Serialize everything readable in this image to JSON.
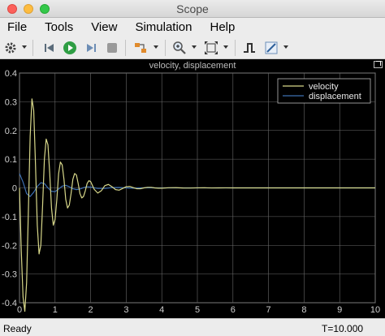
{
  "window": {
    "title": "Scope"
  },
  "menu": [
    "File",
    "Tools",
    "View",
    "Simulation",
    "Help"
  ],
  "toolbar": {
    "icons": [
      "gear-icon",
      "step-back-icon",
      "run-icon",
      "step-forward-icon",
      "stop-icon",
      "highlight-block-icon",
      "zoom-icon",
      "autoscale-icon",
      "triggers-icon",
      "cursor-measurements-icon"
    ]
  },
  "status": {
    "ready": "Ready",
    "time": "T=10.000"
  },
  "colors": {
    "velocity": "#d8d88a",
    "displacement": "#3d6fb0",
    "grid": "#6a6a6a",
    "axes_bg": "#000000",
    "text": "#cfcfcf"
  },
  "chart_data": {
    "type": "line",
    "title": "velocity, displacement",
    "xlim": [
      0,
      10
    ],
    "ylim": [
      -0.4,
      0.4
    ],
    "xticks": [
      0,
      1,
      2,
      3,
      4,
      5,
      6,
      7,
      8,
      9,
      10
    ],
    "yticks": [
      -0.4,
      -0.3,
      -0.2,
      -0.1,
      0,
      0.1,
      0.2,
      0.3,
      0.4
    ],
    "grid": true,
    "legend": "top-right",
    "series": [
      {
        "name": "velocity",
        "color": "#d8d88a",
        "x": [
          0,
          0.05,
          0.1,
          0.15,
          0.2,
          0.25,
          0.3,
          0.35,
          0.4,
          0.45,
          0.5,
          0.55,
          0.6,
          0.65,
          0.7,
          0.75,
          0.8,
          0.85,
          0.9,
          0.95,
          1.0,
          1.05,
          1.1,
          1.15,
          1.2,
          1.25,
          1.3,
          1.35,
          1.4,
          1.45,
          1.5,
          1.55,
          1.6,
          1.65,
          1.7,
          1.75,
          1.8,
          1.85,
          1.9,
          1.95,
          2.0,
          2.1,
          2.2,
          2.3,
          2.4,
          2.5,
          2.6,
          2.7,
          2.8,
          2.9,
          3.0,
          3.1,
          3.2,
          3.3,
          3.4,
          3.5,
          3.6,
          3.7,
          3.8,
          3.9,
          4.0,
          4.2,
          4.4,
          4.6,
          4.8,
          5.0,
          5.2,
          5.4,
          5.6,
          5.8,
          6.0,
          6.5,
          7.0,
          7.5,
          8.0,
          8.5,
          9.0,
          9.5,
          10.0
        ],
        "y": [
          0.0,
          -0.22,
          -0.38,
          -0.43,
          -0.33,
          -0.08,
          0.18,
          0.31,
          0.27,
          0.08,
          -0.13,
          -0.23,
          -0.2,
          -0.06,
          0.1,
          0.17,
          0.15,
          0.05,
          -0.07,
          -0.13,
          -0.11,
          -0.04,
          0.05,
          0.09,
          0.08,
          0.03,
          -0.04,
          -0.07,
          -0.06,
          -0.02,
          0.03,
          0.05,
          0.045,
          0.015,
          -0.02,
          -0.035,
          -0.03,
          -0.01,
          0.015,
          0.025,
          0.022,
          -0.005,
          -0.018,
          -0.01,
          0.008,
          0.012,
          0.004,
          -0.006,
          -0.008,
          -0.002,
          0.004,
          0.005,
          0.001,
          -0.003,
          -0.003,
          0.0,
          0.002,
          0.002,
          0.0,
          -0.001,
          -0.001,
          0.0005,
          0.0008,
          -0.0004,
          -0.0005,
          0.0002,
          0.0003,
          -0.0002,
          0.0,
          0.0001,
          0.0,
          0.0,
          0.0,
          0.0,
          0.0,
          0.0,
          0.0,
          0.0,
          0.0
        ]
      },
      {
        "name": "displacement",
        "color": "#3d6fb0",
        "x": [
          0,
          0.1,
          0.2,
          0.3,
          0.4,
          0.5,
          0.6,
          0.7,
          0.8,
          0.9,
          1.0,
          1.1,
          1.2,
          1.3,
          1.4,
          1.5,
          1.6,
          1.7,
          1.8,
          1.9,
          2.0,
          2.2,
          2.4,
          2.6,
          2.8,
          3.0,
          3.2,
          3.4,
          3.6,
          3.8,
          4.0,
          4.5,
          5.0,
          6.0,
          7.0,
          8.0,
          9.0,
          10.0
        ],
        "y": [
          0.05,
          0.02,
          -0.02,
          -0.03,
          -0.015,
          0.005,
          0.018,
          0.015,
          0.0,
          -0.012,
          -0.013,
          -0.004,
          0.006,
          0.009,
          0.004,
          -0.003,
          -0.006,
          -0.004,
          0.001,
          0.004,
          0.003,
          -0.002,
          -0.002,
          0.001,
          0.0015,
          0.0,
          -0.001,
          0.0,
          0.0005,
          0.0,
          0.0,
          0.0,
          0.0,
          0.0,
          0.0,
          0.0,
          0.0,
          0.0
        ]
      }
    ]
  }
}
